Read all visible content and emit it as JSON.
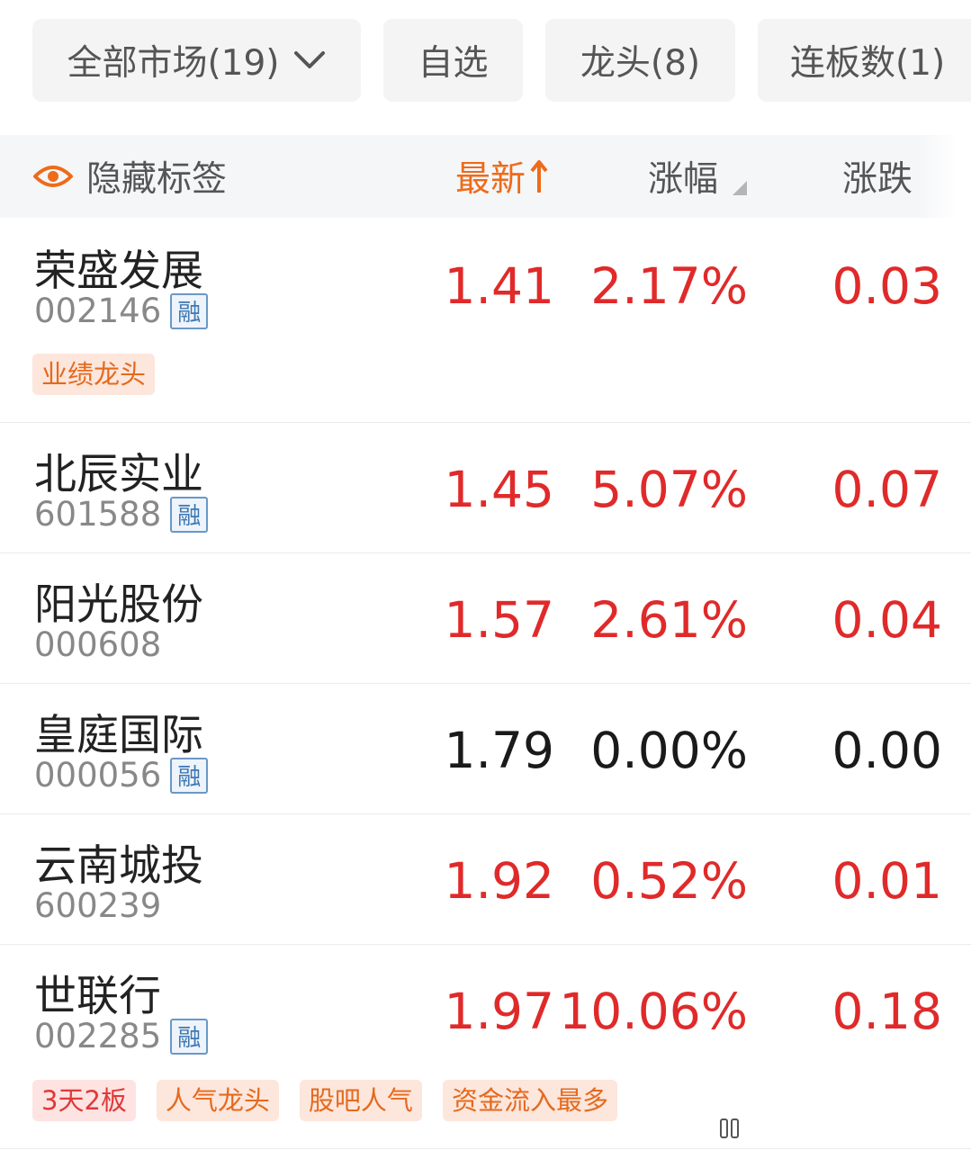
{
  "filters": {
    "all_market": "全部市场(19)",
    "watchlist": "自选",
    "leaders": "龙头(8)",
    "consecutive": "连板数(1)"
  },
  "header": {
    "hide_tags": "隐藏标签",
    "latest": "最新",
    "change_pct": "涨幅",
    "change": "涨跌"
  },
  "colors": {
    "up": "#e02a2a",
    "flat": "#1a1a1a",
    "accent": "#ee6b1a",
    "tag_orange": "#e46a1e",
    "tag_red": "#e0393a",
    "margin_badge": "#3e78b3"
  },
  "rong_label": "融",
  "stocks": [
    {
      "name": "荣盛发展",
      "code": "002146",
      "margin": true,
      "latest": "1.41",
      "change_pct": "2.17%",
      "change": "0.03",
      "trend": "up",
      "tags": [
        "业绩龙头"
      ]
    },
    {
      "name": "北辰实业",
      "code": "601588",
      "margin": true,
      "latest": "1.45",
      "change_pct": "5.07%",
      "change": "0.07",
      "trend": "up",
      "tags": []
    },
    {
      "name": "阳光股份",
      "code": "000608",
      "margin": false,
      "latest": "1.57",
      "change_pct": "2.61%",
      "change": "0.04",
      "trend": "up",
      "tags": []
    },
    {
      "name": "皇庭国际",
      "code": "000056",
      "margin": true,
      "latest": "1.79",
      "change_pct": "0.00%",
      "change": "0.00",
      "trend": "flat",
      "tags": []
    },
    {
      "name": "云南城投",
      "code": "600239",
      "margin": false,
      "latest": "1.92",
      "change_pct": "0.52%",
      "change": "0.01",
      "trend": "up",
      "tags": []
    },
    {
      "name": "世联行",
      "code": "002285",
      "margin": true,
      "latest": "1.97",
      "change_pct": "10.06%",
      "change": "0.18",
      "trend": "up",
      "tags": [
        "3天2板",
        "人气龙头",
        "股吧人气",
        "资金流入最多"
      ]
    }
  ]
}
